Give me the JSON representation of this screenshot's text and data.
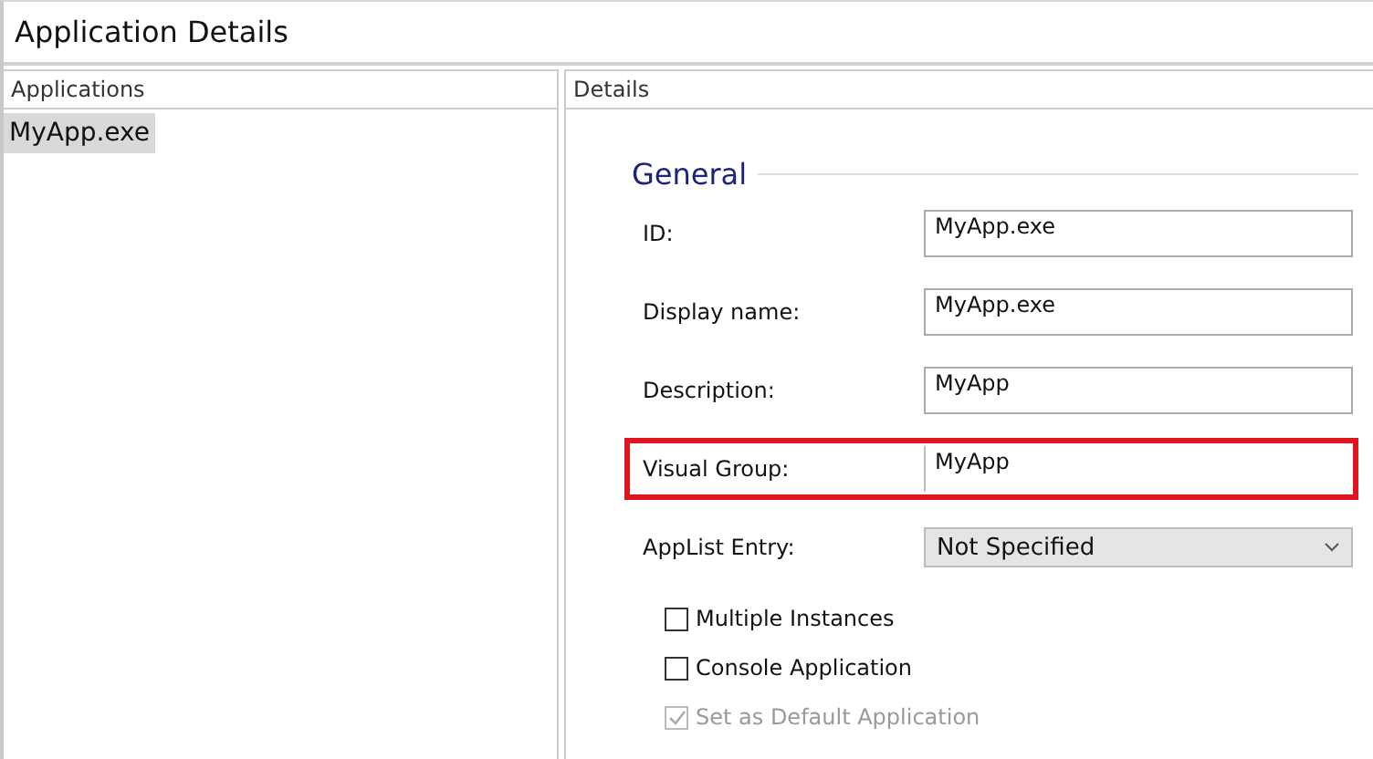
{
  "window": {
    "title": "Application Details"
  },
  "applications": {
    "header": "Applications",
    "items": [
      {
        "label": "MyApp.exe",
        "selected": true
      }
    ]
  },
  "details": {
    "header": "Details",
    "section": "General",
    "fields": [
      {
        "kind": "text",
        "label": "ID:",
        "value": "MyApp.exe",
        "highlighted": false
      },
      {
        "kind": "text",
        "label": "Display name:",
        "value": "MyApp.exe",
        "highlighted": false
      },
      {
        "kind": "text",
        "label": "Description:",
        "value": "MyApp",
        "highlighted": false
      },
      {
        "kind": "text",
        "label": "Visual Group:",
        "value": "MyApp",
        "highlighted": true
      },
      {
        "kind": "dropdown",
        "label": "AppList Entry:",
        "value": "Not Specified",
        "highlighted": false
      }
    ],
    "checkboxes": [
      {
        "label": "Multiple Instances",
        "checked": false,
        "disabled": false
      },
      {
        "label": "Console Application",
        "checked": false,
        "disabled": false
      },
      {
        "label": "Set as Default Application",
        "checked": true,
        "disabled": true
      }
    ]
  }
}
